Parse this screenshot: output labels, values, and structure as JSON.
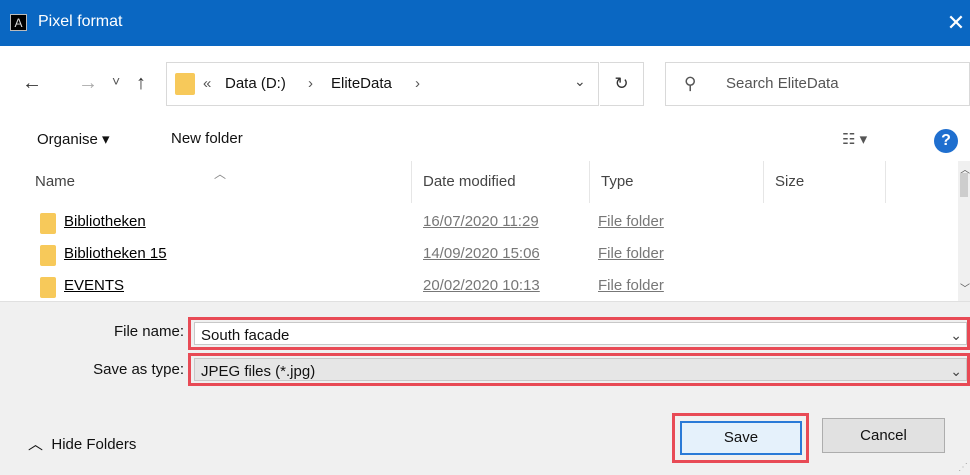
{
  "window": {
    "title": "Pixel format",
    "app_icon_letter": "A"
  },
  "nav": {
    "back": "←",
    "forward": "→",
    "recent": "˅",
    "up": "↑"
  },
  "address": {
    "overflow": "«",
    "crumbs": [
      "Data (D:)",
      "EliteData"
    ],
    "separator": "›"
  },
  "search": {
    "placeholder": "Search EliteData"
  },
  "toolbar": {
    "organise": "Organise ▾",
    "new_folder": "New folder",
    "view": "☷ ▾",
    "help": "?"
  },
  "columns": [
    "Name",
    "Date modified",
    "Type",
    "Size"
  ],
  "files": [
    {
      "name": "Bibliotheken",
      "date": "16/07/2020 11:29",
      "type": "File folder"
    },
    {
      "name": "Bibliotheken 15",
      "date": "14/09/2020 15:06",
      "type": "File folder"
    },
    {
      "name": "EVENTS",
      "date": "20/02/2020 10:13",
      "type": "File folder"
    }
  ],
  "form": {
    "file_name_label": "File name:",
    "file_name_value": "South facade",
    "save_type_label": "Save as type:",
    "save_type_value": "JPEG files (*.jpg)"
  },
  "footer": {
    "hide_folders": "Hide Folders",
    "save": "Save",
    "cancel": "Cancel"
  },
  "colors": {
    "titlebar": "#0a67c2",
    "highlight": "#e84a55",
    "folder": "#f7c95a"
  }
}
